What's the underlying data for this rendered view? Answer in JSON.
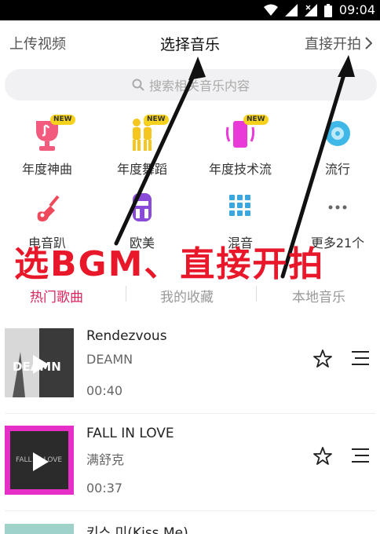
{
  "status": {
    "time": "09:04"
  },
  "header": {
    "left": "上传视频",
    "title": "选择音乐",
    "right": "直接开拍"
  },
  "search": {
    "placeholder": "搜索相关音乐内容"
  },
  "categories": [
    {
      "label": "年度神曲",
      "badge": "NEW",
      "icon": "trophy-icon"
    },
    {
      "label": "年度舞蹈",
      "badge": "NEW",
      "icon": "dancers-icon"
    },
    {
      "label": "年度技术流",
      "badge": "NEW",
      "icon": "tech-icon"
    },
    {
      "label": "流行",
      "icon": "vinyl-icon"
    },
    {
      "label": "电音趴",
      "icon": "guitar-icon"
    },
    {
      "label": "欧美",
      "icon": "headphones-icon"
    },
    {
      "label": "混音",
      "icon": "grid-icon"
    },
    {
      "label": "更多21个",
      "icon": "more-icon"
    }
  ],
  "overlay": {
    "text": "选BGM、直接开拍"
  },
  "tabs": [
    {
      "label": "热门歌曲",
      "active": true
    },
    {
      "label": "我的收藏"
    },
    {
      "label": "本地音乐"
    }
  ],
  "songs": [
    {
      "title": "Rendezvous",
      "artist": "DEAMN",
      "duration": "00:40",
      "cover_text": "DEAMN"
    },
    {
      "title": "FALL IN LOVE",
      "artist": "满舒克",
      "duration": "00:37",
      "cover_text": "FALL IN LOVE"
    },
    {
      "title": "키스 미(Kiss Me)"
    }
  ],
  "colors": {
    "accent": "#d9245c",
    "overlay_red": "#e8182a",
    "badge_yellow": "#f7d21c"
  }
}
